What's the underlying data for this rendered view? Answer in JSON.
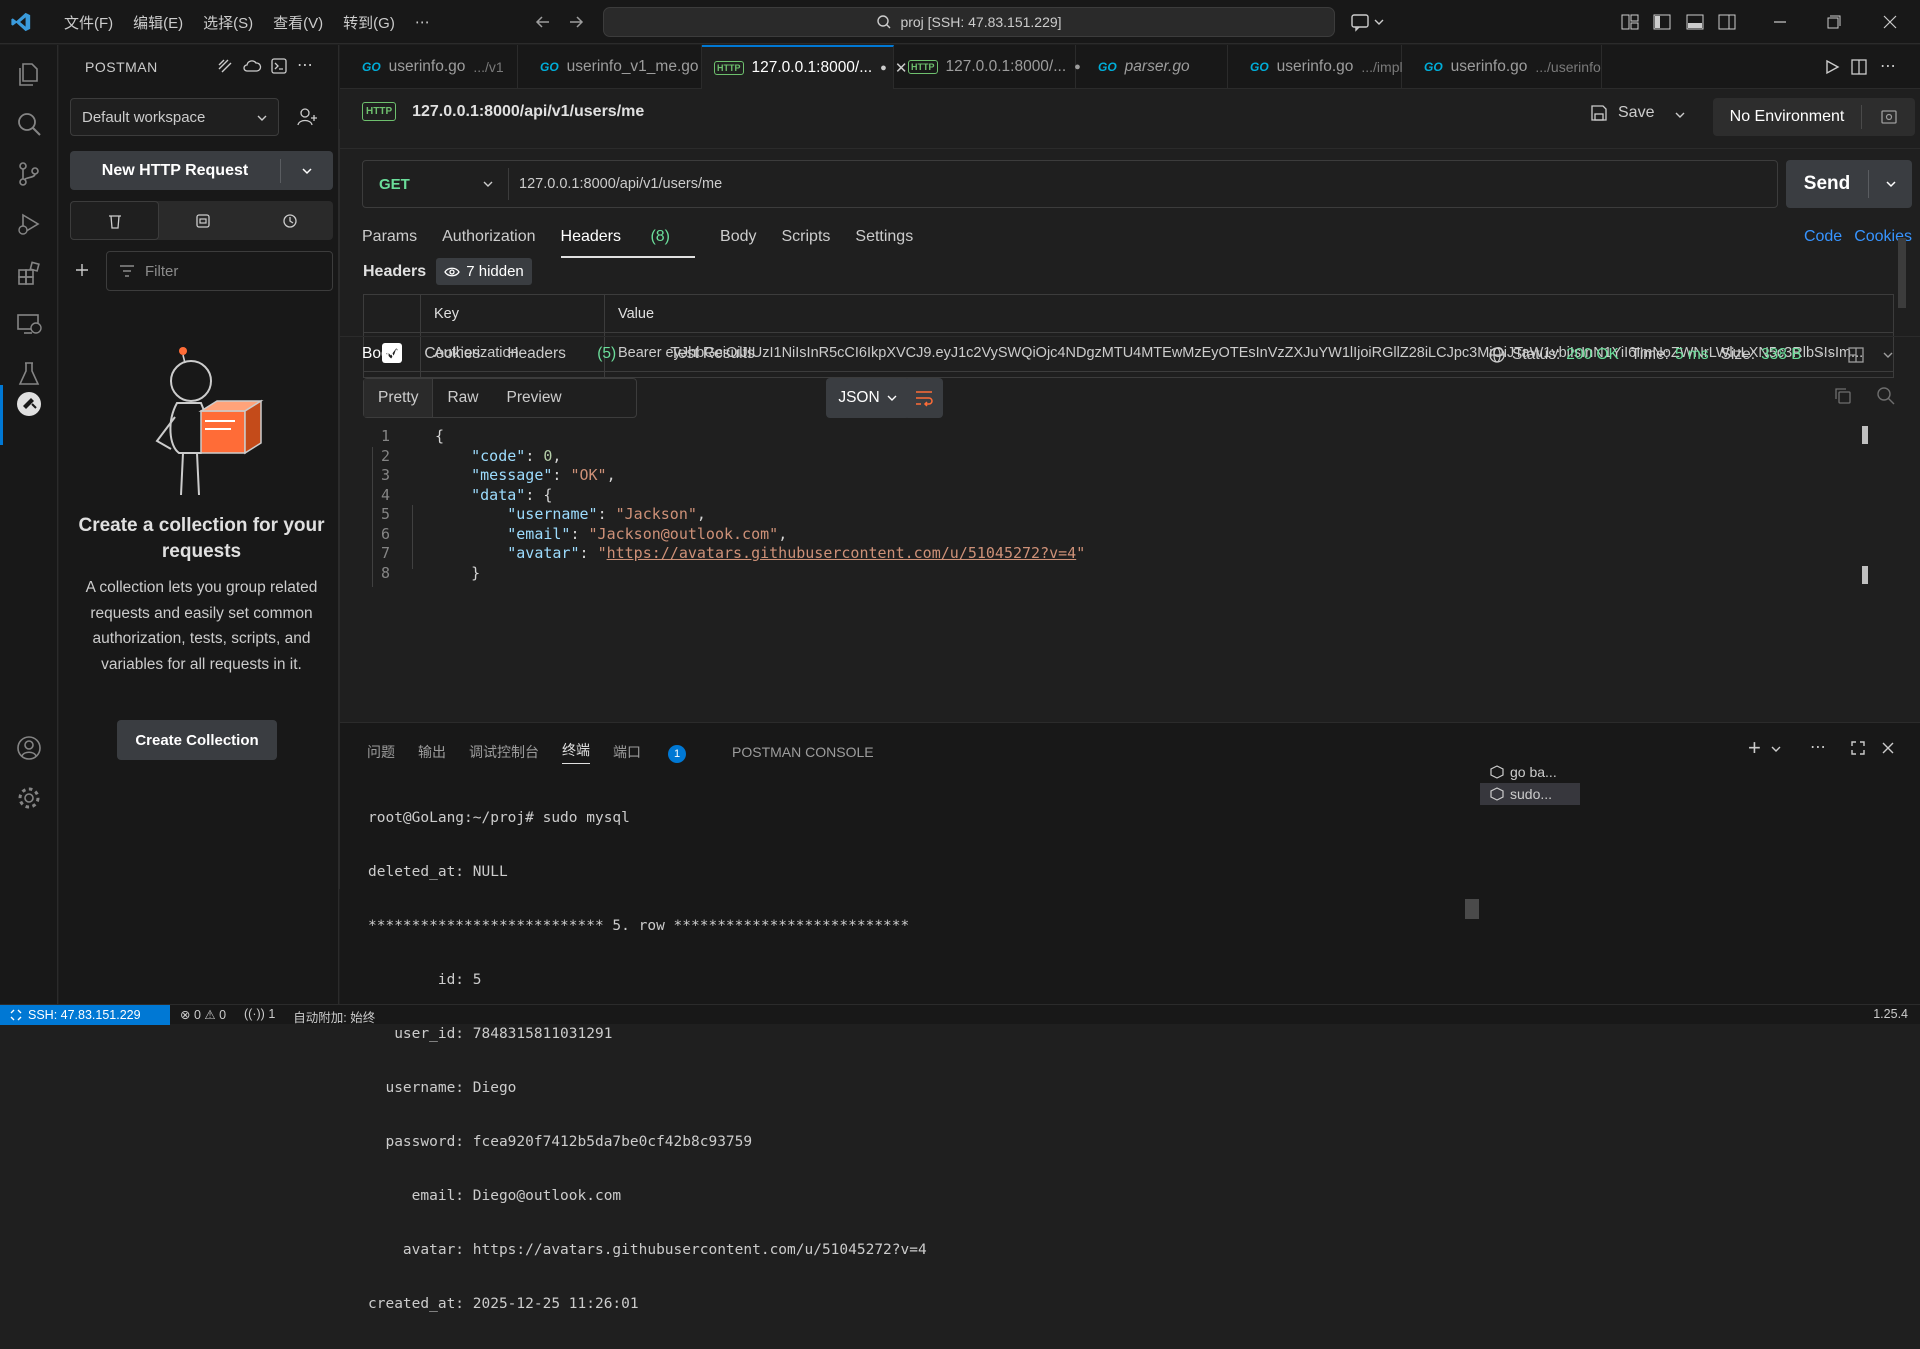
{
  "titlebar": {
    "menu": [
      "文件(F)",
      "编辑(E)",
      "选择(S)",
      "查看(V)",
      "转到(G)",
      "⋯"
    ],
    "search_text": "proj [SSH: 47.83.151.229]"
  },
  "sidebar": {
    "title": "POSTMAN",
    "workspace": "Default workspace",
    "new_request": "New HTTP Request",
    "filter_placeholder": "Filter",
    "empty_title": "Create a collection for your requests",
    "empty_desc": "A collection lets you group related requests and easily set common authorization, tests, scripts, and variables for all requests in it.",
    "create_button": "Create Collection"
  },
  "tabs": [
    {
      "icon": "go",
      "label": "userinfo.go",
      "path": ".../v1"
    },
    {
      "icon": "go",
      "label": "userinfo_v1_me.go",
      "path": ""
    },
    {
      "icon": "http",
      "label": "127.0.0.1:8000/...",
      "path": ""
    },
    {
      "icon": "http",
      "label": "127.0.0.1:8000/...",
      "path": ""
    },
    {
      "icon": "go",
      "label": "parser.go",
      "path": ""
    },
    {
      "icon": "go",
      "label": "userinfo.go",
      "path": ".../impl"
    },
    {
      "icon": "go",
      "label": "userinfo.go",
      "path": ".../userinfo"
    }
  ],
  "request": {
    "title": "127.0.0.1:8000/api/v1/users/me",
    "save": "Save",
    "environment": "No Environment",
    "method": "GET",
    "url": "127.0.0.1:8000/api/v1/users/me",
    "send": "Send",
    "tabs": {
      "params": "Params",
      "authorization": "Authorization",
      "headers": "Headers",
      "headers_count": "(8)",
      "body": "Body",
      "scripts": "Scripts",
      "settings": "Settings"
    },
    "code": "Code",
    "cookies": "Cookies",
    "headers_title": "Headers",
    "hidden": "7 hidden",
    "table": {
      "col_key": "Key",
      "col_value": "Value",
      "row_key": "Authorization",
      "row_value": "Bearer eyJhbGciOiJIUzI1NiIsInR5cCI6IkpXVCJ9.eyJ1c2VySWQiOjc4NDgzMTU4MTEwMzEyOTEsInVzZXJuYW1lIjoiRGllZ28iLCJpc3MiOiJTaW1vbiIsInN1YiI6ImNoZWNrLWluLXN5c3RlbSIsIm...",
      "key_placeholder": "Key",
      "value_placeholder": "Value"
    }
  },
  "response": {
    "tabs": {
      "body": "Body",
      "cookies": "Cookies",
      "headers": "Headers",
      "headers_count": "(5)",
      "tests": "Test Results"
    },
    "status_label": "Status:",
    "status": "200 OK",
    "time_label": "Time:",
    "time": "5 ms",
    "size_label": "Size:",
    "size": "338 B",
    "views": [
      "Pretty",
      "Raw",
      "Preview"
    ],
    "format": "JSON"
  },
  "panel": {
    "tabs": [
      "问题",
      "输出",
      "调试控制台",
      "终端",
      "端口",
      "POSTMAN CONSOLE"
    ],
    "ports_badge": "1",
    "terminal_lines": [
      "root@GoLang:~/proj# sudo mysql",
      "deleted_at: NULL",
      "*************************** 5. row ***************************",
      "        id: 5",
      "   user_id: 7848315811031291",
      "  username: Diego",
      "  password: fcea920f7412b5da7be0cf42b8c93759",
      "     email: Diego@outlook.com",
      "    avatar: https://avatars.githubusercontent.com/u/51045272?v=4",
      "created_at: 2025-12-25 11:26:01"
    ],
    "terminal_list": [
      "go  ba...",
      "sudo..."
    ]
  },
  "statusbar": {
    "remote": "SSH: 47.83.151.229",
    "errors": "0",
    "warnings": "0",
    "ports": "1",
    "autoattach": "自动附加: 始终",
    "version": "1.25.4"
  }
}
